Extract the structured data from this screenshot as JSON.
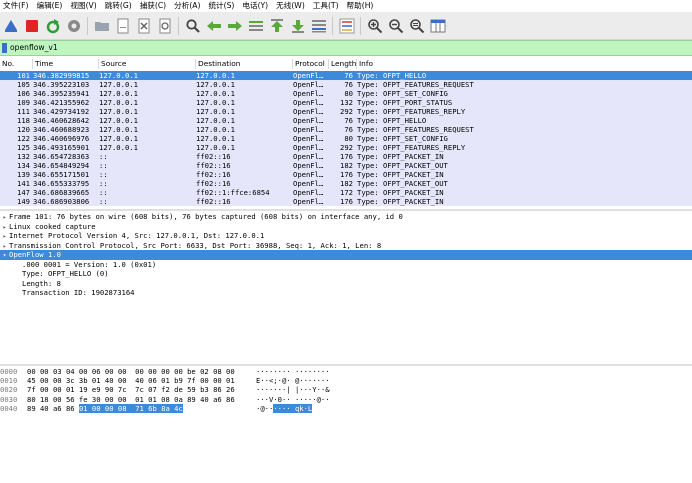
{
  "menu": [
    "文件(F)",
    "编辑(E)",
    "视图(V)",
    "跳转(G)",
    "捕获(C)",
    "分析(A)",
    "统计(S)",
    "电话(Y)",
    "无线(W)",
    "工具(T)",
    "帮助(H)"
  ],
  "toolbar_icons": [
    "shark-fin-icon",
    "stop-icon",
    "restart-icon",
    "options-gear-icon",
    "open-folder-icon",
    "save-file-icon",
    "close-file-icon",
    "reload-icon",
    "find-icon",
    "back-arrow-icon",
    "forward-arrow-icon",
    "goto-packet-icon",
    "first-packet-icon",
    "last-packet-icon",
    "autoscroll-icon",
    "colorize-icon",
    "zoom-in-icon",
    "zoom-out-icon",
    "zoom-reset-icon",
    "resize-columns-icon"
  ],
  "colors": {
    "selected": "#3c8ad9",
    "row_bg": "#e6e6fa",
    "filter_ok": "#bff6bf"
  },
  "filter": {
    "value": "openflow_v1"
  },
  "columns": [
    "No.",
    "Time",
    "Source",
    "Destination",
    "Protocol",
    "Length",
    "Info"
  ],
  "packets": [
    {
      "no": "101",
      "time": "346.382999815",
      "src": "127.0.0.1",
      "dst": "127.0.0.1",
      "proto": "OpenFl…",
      "len": "76",
      "info": "Type: OFPT_HELLO",
      "selected": true
    },
    {
      "no": "105",
      "time": "346.395223103",
      "src": "127.0.0.1",
      "dst": "127.0.0.1",
      "proto": "OpenFl…",
      "len": "76",
      "info": "Type: OFPT_FEATURES_REQUEST"
    },
    {
      "no": "106",
      "time": "346.395235941",
      "src": "127.0.0.1",
      "dst": "127.0.0.1",
      "proto": "OpenFl…",
      "len": "80",
      "info": "Type: OFPT_SET_CONFIG"
    },
    {
      "no": "109",
      "time": "346.421355962",
      "src": "127.0.0.1",
      "dst": "127.0.0.1",
      "proto": "OpenFl…",
      "len": "132",
      "info": "Type: OFPT_PORT_STATUS"
    },
    {
      "no": "111",
      "time": "346.429734192",
      "src": "127.0.0.1",
      "dst": "127.0.0.1",
      "proto": "OpenFl…",
      "len": "292",
      "info": "Type: OFPT_FEATURES_REPLY"
    },
    {
      "no": "118",
      "time": "346.460628642",
      "src": "127.0.0.1",
      "dst": "127.0.0.1",
      "proto": "OpenFl…",
      "len": "76",
      "info": "Type: OFPT_HELLO"
    },
    {
      "no": "120",
      "time": "346.460688923",
      "src": "127.0.0.1",
      "dst": "127.0.0.1",
      "proto": "OpenFl…",
      "len": "76",
      "info": "Type: OFPT_FEATURES_REQUEST"
    },
    {
      "no": "122",
      "time": "346.460696976",
      "src": "127.0.0.1",
      "dst": "127.0.0.1",
      "proto": "OpenFl…",
      "len": "80",
      "info": "Type: OFPT_SET_CONFIG"
    },
    {
      "no": "125",
      "time": "346.493165901",
      "src": "127.0.0.1",
      "dst": "127.0.0.1",
      "proto": "OpenFl…",
      "len": "292",
      "info": "Type: OFPT_FEATURES_REPLY"
    },
    {
      "no": "132",
      "time": "346.654728363",
      "src": "::",
      "dst": "ff02::16",
      "proto": "OpenFl…",
      "len": "176",
      "info": "Type: OFPT_PACKET_IN"
    },
    {
      "no": "134",
      "time": "346.654849294",
      "src": "::",
      "dst": "ff02::16",
      "proto": "OpenFl…",
      "len": "182",
      "info": "Type: OFPT_PACKET_OUT"
    },
    {
      "no": "139",
      "time": "346.655171501",
      "src": "::",
      "dst": "ff02::16",
      "proto": "OpenFl…",
      "len": "176",
      "info": "Type: OFPT_PACKET_IN"
    },
    {
      "no": "141",
      "time": "346.655333795",
      "src": "::",
      "dst": "ff02::16",
      "proto": "OpenFl…",
      "len": "182",
      "info": "Type: OFPT_PACKET_OUT"
    },
    {
      "no": "147",
      "time": "346.686839665",
      "src": "::",
      "dst": "ff02::1:ffce:6854",
      "proto": "OpenFl…",
      "len": "172",
      "info": "Type: OFPT_PACKET_IN"
    },
    {
      "no": "149",
      "time": "346.686903806",
      "src": "::",
      "dst": "ff02::16",
      "proto": "OpenFl…",
      "len": "176",
      "info": "Type: OFPT_PACKET_IN"
    }
  ],
  "details": [
    {
      "text": "Frame 101: 76 bytes on wire (608 bits), 76 bytes captured (608 bits) on interface any, id 0",
      "arrow": "▸"
    },
    {
      "text": "Linux cooked capture",
      "arrow": "▸"
    },
    {
      "text": "Internet Protocol Version 4, Src: 127.0.0.1, Dst: 127.0.0.1",
      "arrow": "▸"
    },
    {
      "text": "Transmission Control Protocol, Src Port: 6633, Dst Port: 36988, Seq: 1, Ack: 1, Len: 8",
      "arrow": "▸"
    },
    {
      "text": "OpenFlow 1.0",
      "arrow": "▾",
      "selected": true
    },
    {
      "text": ".000 0001 = Version: 1.0 (0x01)",
      "sub": true
    },
    {
      "text": "Type: OFPT_HELLO (0)",
      "sub": true
    },
    {
      "text": "Length: 8",
      "sub": true
    },
    {
      "text": "Transaction ID: 1902873164",
      "sub": true
    }
  ],
  "bytes": [
    {
      "off": "0000",
      "hex": "00 00 03 04 00 06 00 00  00 00 00 00 be 02 08 00",
      "hl": "",
      "hex_rest": "",
      "asc": "········ ········",
      "asc_hl": "",
      "asc_rest": ""
    },
    {
      "off": "0010",
      "hex": "45 00 00 3c 3b 01 40 00  40 06 01 b9 7f 00 00 01",
      "hl": "",
      "hex_rest": "",
      "asc": "E··<;·@· @·······",
      "asc_hl": "",
      "asc_rest": ""
    },
    {
      "off": "0020",
      "hex": "7f 00 00 01 19 e9 90 7c  7c 07 f2 de 59 b3 86 26",
      "hl": "",
      "hex_rest": "",
      "asc": "·······| |···Y··&",
      "asc_hl": "",
      "asc_rest": ""
    },
    {
      "off": "0030",
      "hex": "80 18 00 56 fe 30 00 00  01 01 08 0a 89 40 a6 86",
      "hl": "",
      "hex_rest": "",
      "asc": "···V·0·· ·····@··",
      "asc_hl": "",
      "asc_rest": ""
    },
    {
      "off": "0040",
      "hex": "89 40 a6 86 ",
      "hl": "01 00 00 08  71 6b 8a 4c",
      "hex_rest": "",
      "asc": "·@··",
      "asc_hl": "···· qk·L",
      "asc_rest": ""
    }
  ]
}
